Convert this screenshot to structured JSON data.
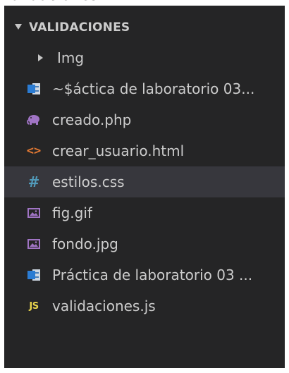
{
  "window_title_partial": "Validaciones",
  "explorer": {
    "section_title": "VALIDACIONES",
    "items": [
      {
        "label": "Img",
        "type": "folder",
        "icon": "chevron-right-icon"
      },
      {
        "label": "~$áctica de laboratorio 03...",
        "type": "file",
        "icon": "word-icon"
      },
      {
        "label": "creado.php",
        "type": "file",
        "icon": "php-elephant-icon"
      },
      {
        "label": "crear_usuario.html",
        "type": "file",
        "icon": "html-code-icon"
      },
      {
        "label": "estilos.css",
        "type": "file",
        "icon": "css-hash-icon",
        "selected": true
      },
      {
        "label": "fig.gif",
        "type": "file",
        "icon": "image-icon"
      },
      {
        "label": "fondo.jpg",
        "type": "file",
        "icon": "image-icon"
      },
      {
        "label": "Práctica de laboratorio 03 ...",
        "type": "file",
        "icon": "word-icon"
      },
      {
        "label": "validaciones.js",
        "type": "file",
        "icon": "js-icon"
      }
    ]
  },
  "icon_glyphs": {
    "css": "#",
    "html": "<>",
    "js": "JS"
  },
  "colors": {
    "panel_background": "#252526",
    "selected_row": "#37373d",
    "text": "#cccccc",
    "php_icon": "#a074c4",
    "html_icon": "#e37933",
    "css_icon": "#519aba",
    "image_icon": "#a074c4",
    "word_icon": "#2b7cd3",
    "js_icon": "#e8d44d"
  }
}
